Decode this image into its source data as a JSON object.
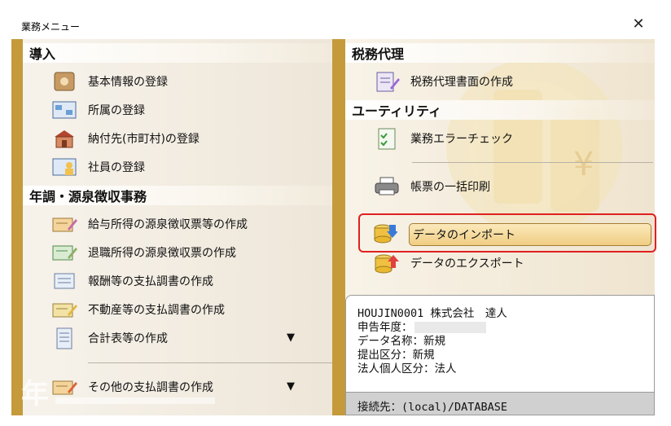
{
  "window": {
    "title": "業務メニュー"
  },
  "left": {
    "section1": {
      "title": "導入",
      "items": [
        {
          "label": "基本情報の登録",
          "icon": "basic-info-icon"
        },
        {
          "label": "所属の登録",
          "icon": "department-icon"
        },
        {
          "label": "納付先(市町村)の登録",
          "icon": "municipality-icon"
        },
        {
          "label": "社員の登録",
          "icon": "employee-icon"
        }
      ]
    },
    "section2": {
      "title": "年調・源泉徴収事務",
      "items": [
        {
          "label": "給与所得の源泉徴収票等の作成",
          "icon": "salary-slip-icon"
        },
        {
          "label": "退職所得の源泉徴収票の作成",
          "icon": "retirement-slip-icon"
        },
        {
          "label": "報酬等の支払調書の作成",
          "icon": "remuneration-doc-icon"
        },
        {
          "label": "不動産等の支払調書の作成",
          "icon": "real-estate-doc-icon"
        },
        {
          "label": "合計表等の作成",
          "icon": "summary-table-icon"
        },
        {
          "label": "その他の支払調書の作成",
          "icon": "other-doc-icon"
        }
      ]
    },
    "arrow": "▼"
  },
  "right": {
    "section1": {
      "title": "税務代理",
      "items": [
        {
          "label": "税務代理書面の作成",
          "icon": "tax-agent-doc-icon"
        }
      ]
    },
    "section2": {
      "title": "ユーティリティ",
      "items": [
        {
          "label": "業務エラーチェック",
          "icon": "error-check-icon"
        },
        {
          "label": "帳票の一括印刷",
          "icon": "printer-icon"
        },
        {
          "label": "データのインポート",
          "icon": "import-icon"
        },
        {
          "label": "データのエクスポート",
          "icon": "export-icon"
        }
      ]
    }
  },
  "info": {
    "company": "HOUJIN0001 株式会社　達人",
    "fiscal_year_label": "申告年度：",
    "data_name": "データ名称：新規",
    "submission": "提出区分：新規",
    "entity_type": "法人個人区分：法人",
    "connection": "接続先：(local)/DATABASE"
  },
  "colors": {
    "accent_gold": "#c59a3b",
    "highlight_red": "#e02020"
  }
}
